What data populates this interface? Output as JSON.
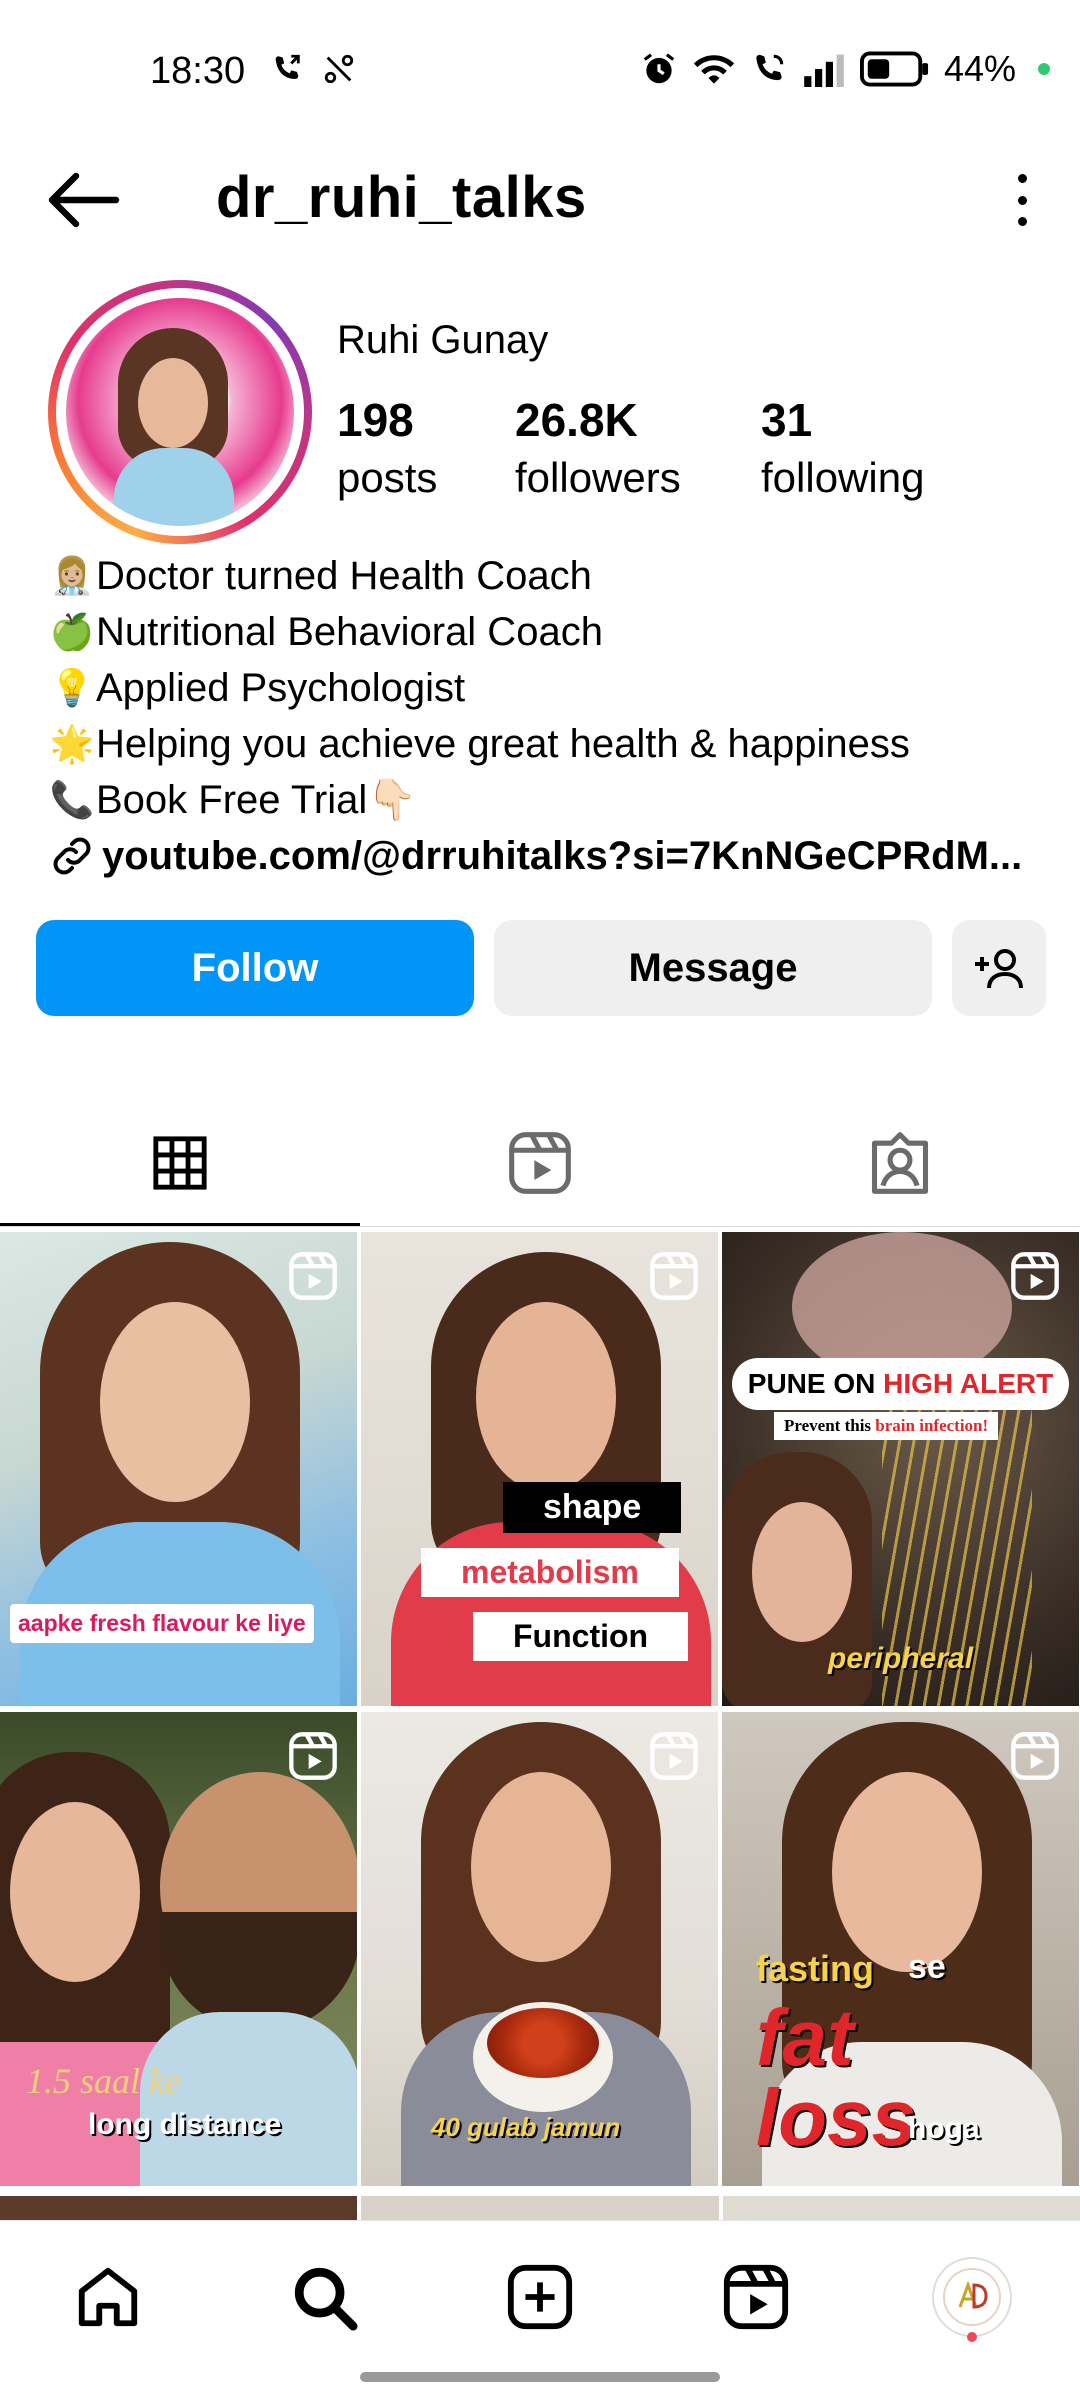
{
  "status_bar": {
    "time": "18:30",
    "battery_text": "44%",
    "icons": [
      "phone-forward-icon",
      "no-signal-icon",
      "alarm-icon",
      "wifi-icon",
      "call-icon",
      "signal-icon",
      "battery-icon"
    ]
  },
  "header": {
    "username": "dr_ruhi_talks"
  },
  "profile": {
    "display_name": "Ruhi Gunay",
    "stats": {
      "posts": {
        "num": "198",
        "label": "posts"
      },
      "followers": {
        "num": "26.8K",
        "label": "followers"
      },
      "following": {
        "num": "31",
        "label": "following"
      }
    },
    "bio": [
      {
        "emoji": "👩🏼‍⚕️",
        "text": "Doctor turned Health Coach"
      },
      {
        "emoji": "🍏",
        "text": "Nutritional Behavioral Coach"
      },
      {
        "emoji": "💡",
        "text": "Applied Psychologist"
      },
      {
        "emoji": "🌟",
        "text": "Helping you achieve great health & happiness"
      },
      {
        "emoji": "📞",
        "text": "Book Free Trial👇🏻"
      }
    ],
    "link": "youtube.com/@drruhitalks?si=7KnNGeCPRdM..."
  },
  "actions": {
    "follow": "Follow",
    "message": "Message"
  },
  "tabs": [
    "grid",
    "reels",
    "tagged"
  ],
  "posts": [
    {
      "caption": "aapke fresh flavour ke liye"
    },
    {
      "caption_lines": [
        "shape",
        "metabolism",
        "Function"
      ]
    },
    {
      "headline_a": "PUNE ON ",
      "headline_b": "HIGH ALERT",
      "sub_a": "Prevent this ",
      "sub_b": "brain infection!",
      "caption": "peripheral"
    },
    {
      "caption_lines": [
        "1.5 saal ke",
        "long distance"
      ]
    },
    {
      "caption": "40 gulab jamun"
    },
    {
      "caption_lines": [
        "fasting",
        "se",
        "fat",
        "loss",
        "hoga"
      ]
    }
  ],
  "colors": {
    "follow_blue": "#0095f6",
    "button_gray": "#efefef",
    "accent_red": "#e0262b",
    "caption_yellow": "#f7d34a",
    "caption_pink": "#d81b60"
  }
}
